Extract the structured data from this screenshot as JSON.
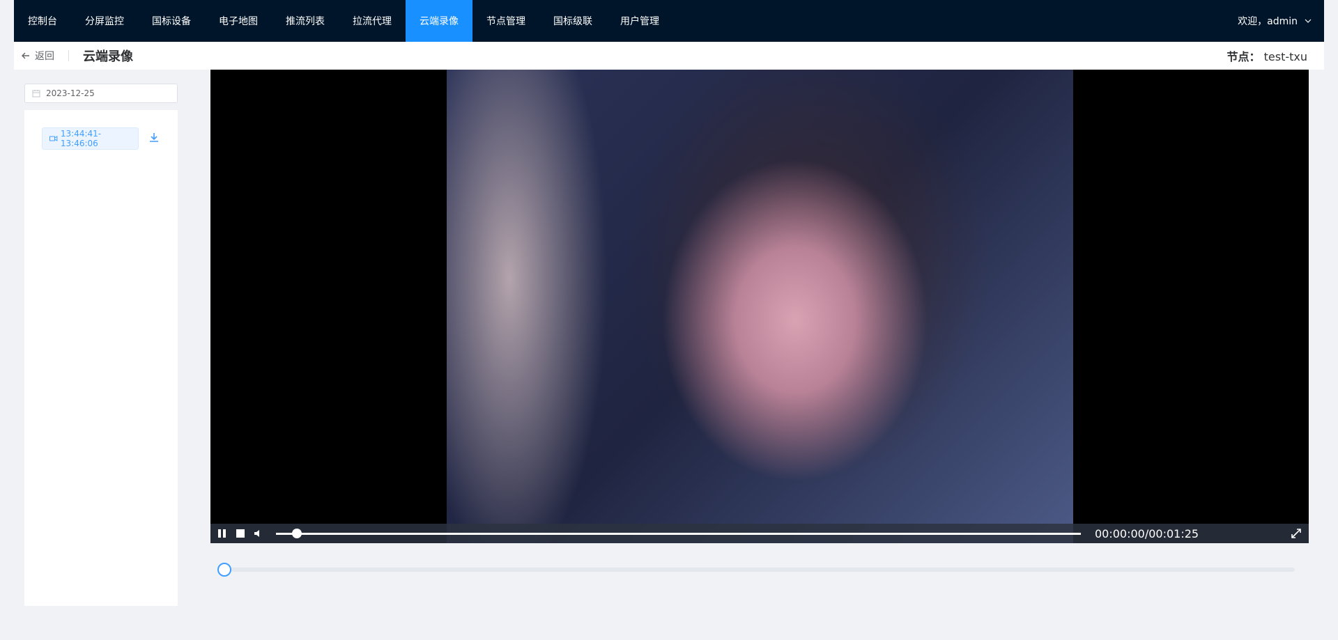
{
  "nav": {
    "items": [
      {
        "label": "控制台"
      },
      {
        "label": "分屏监控"
      },
      {
        "label": "国标设备"
      },
      {
        "label": "电子地图"
      },
      {
        "label": "推流列表"
      },
      {
        "label": "拉流代理"
      },
      {
        "label": "云端录像",
        "active": true
      },
      {
        "label": "节点管理"
      },
      {
        "label": "国标级联"
      },
      {
        "label": "用户管理"
      }
    ],
    "user": "欢迎，admin",
    "active_color": "#1890ff",
    "bg_color": "#001529"
  },
  "header": {
    "back_label": "返回",
    "title": "云端录像",
    "node_key": "节点：",
    "node_value": "test-txu"
  },
  "sidebar": {
    "date_value": "2023-12-25",
    "recordings": [
      {
        "label": "13:44:41-13:46:06"
      }
    ]
  },
  "player": {
    "time": "00:00:00/00:01:25",
    "progress_fraction": 0.02
  },
  "timeline": {
    "position_fraction": 0
  }
}
